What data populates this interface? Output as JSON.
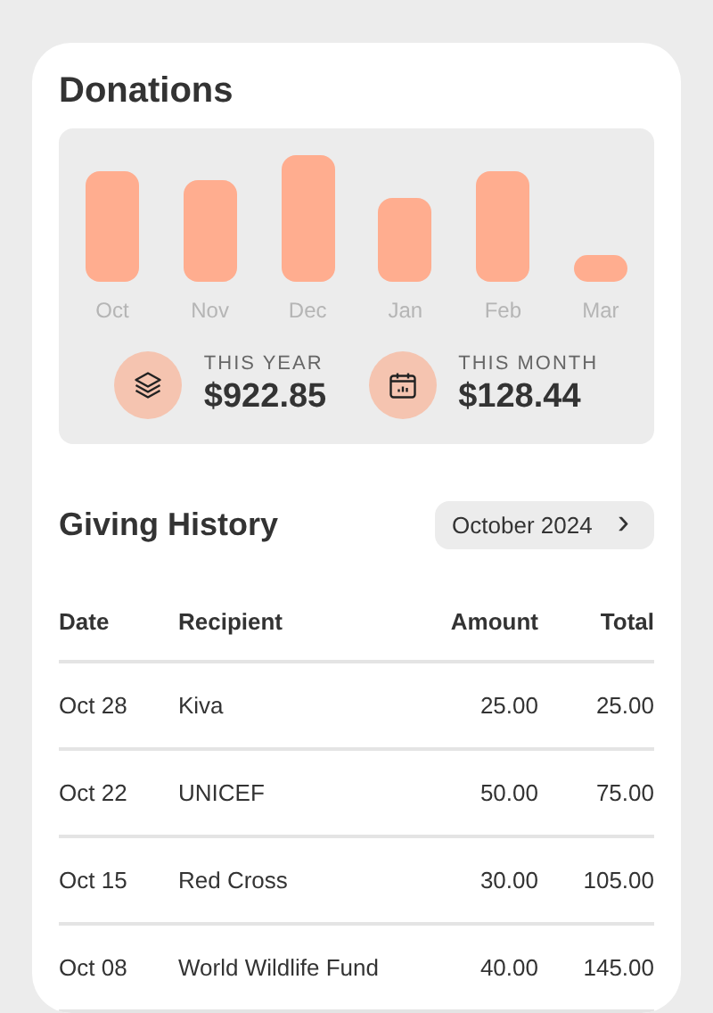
{
  "donations": {
    "title": "Donations",
    "bars": [
      {
        "label": "Oct"
      },
      {
        "label": "Nov"
      },
      {
        "label": "Dec"
      },
      {
        "label": "Jan"
      },
      {
        "label": "Feb"
      },
      {
        "label": "Mar"
      }
    ],
    "stats": [
      {
        "kind": "year",
        "label": "THIS YEAR",
        "value": "$922.85"
      },
      {
        "kind": "month",
        "label": "THIS MONTH",
        "value": "$128.44"
      }
    ]
  },
  "history": {
    "title": "Giving History",
    "period": "October 2024",
    "period_next": "›",
    "columns": [
      "Date",
      "Recipient",
      "Amount",
      "Total"
    ],
    "rows": [
      [
        "Oct 28",
        "Kiva",
        "25.00",
        "25.00"
      ],
      [
        "Oct 22",
        "UNICEF",
        "50.00",
        "75.00"
      ],
      [
        "Oct 15",
        "Red Cross",
        "30.00",
        "105.00"
      ],
      [
        "Oct 08",
        "World Wildlife Fund",
        "40.00",
        "145.00"
      ]
    ]
  }
}
